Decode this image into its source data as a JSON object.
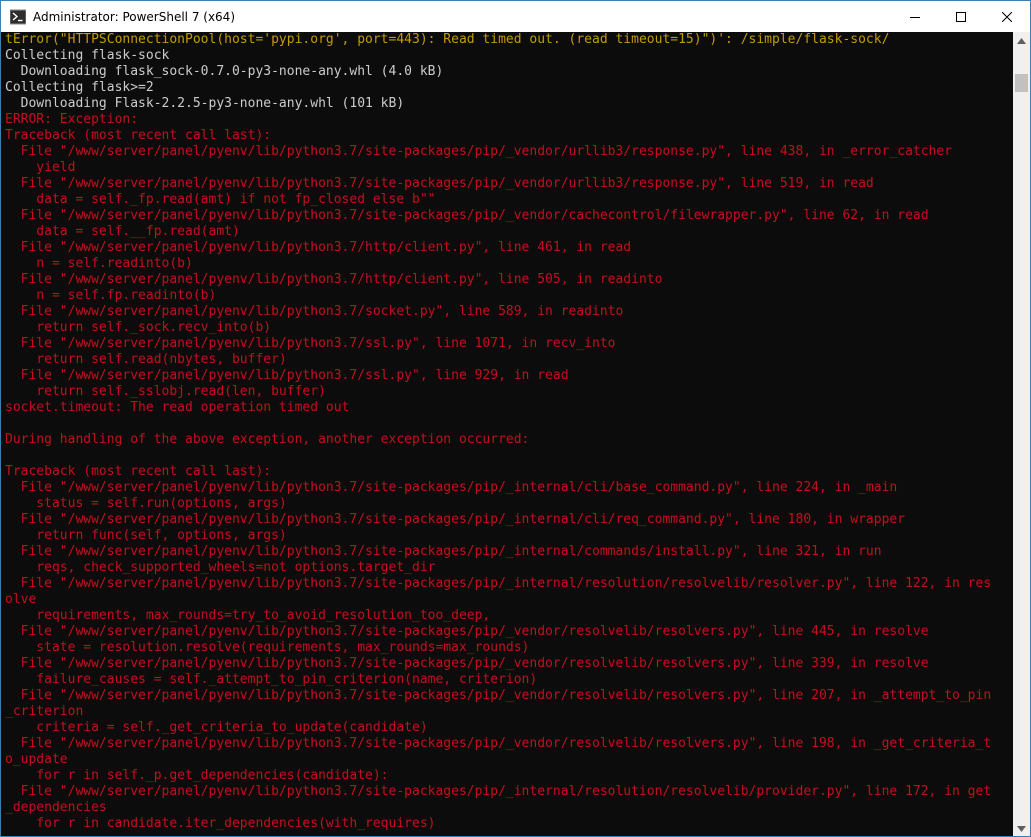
{
  "window": {
    "title": "Administrator: PowerShell 7 (x64)"
  },
  "colors": {
    "title_bar": "#ffffff",
    "terminal_bg": "#0c0c0c",
    "normal": "#cccccc",
    "warning": "#c19c00",
    "error": "#c50f1f"
  },
  "icons": {
    "app": "powershell-icon",
    "minimize": "minimize-icon",
    "maximize": "maximize-icon",
    "close": "close-icon",
    "scroll_up": "scroll-up-arrow-icon",
    "scroll_down": "scroll-down-arrow-icon"
  },
  "terminal": {
    "lines": [
      {
        "text": "tError(\"HTTPSConnectionPool(host='pypi.org', port=443): Read timed out. (read timeout=15)\")': /simple/flask-sock/",
        "color": "#c19c00"
      },
      {
        "text": "Collecting flask-sock",
        "color": "#cccccc"
      },
      {
        "text": "  Downloading flask_sock-0.7.0-py3-none-any.whl (4.0 kB)",
        "color": "#cccccc"
      },
      {
        "text": "Collecting flask>=2",
        "color": "#cccccc"
      },
      {
        "text": "  Downloading Flask-2.2.5-py3-none-any.whl (101 kB)",
        "color": "#cccccc"
      },
      {
        "text": "ERROR: Exception:",
        "color": "#c50f1f"
      },
      {
        "text": "Traceback (most recent call last):",
        "color": "#c50f1f"
      },
      {
        "text": "  File \"/www/server/panel/pyenv/lib/python3.7/site-packages/pip/_vendor/urllib3/response.py\", line 438, in _error_catcher",
        "color": "#c50f1f"
      },
      {
        "text": "    yield",
        "color": "#c50f1f"
      },
      {
        "text": "  File \"/www/server/panel/pyenv/lib/python3.7/site-packages/pip/_vendor/urllib3/response.py\", line 519, in read",
        "color": "#c50f1f"
      },
      {
        "text": "    data = self._fp.read(amt) if not fp_closed else b\"\"",
        "color": "#c50f1f"
      },
      {
        "text": "  File \"/www/server/panel/pyenv/lib/python3.7/site-packages/pip/_vendor/cachecontrol/filewrapper.py\", line 62, in read",
        "color": "#c50f1f"
      },
      {
        "text": "    data = self.__fp.read(amt)",
        "color": "#c50f1f"
      },
      {
        "text": "  File \"/www/server/panel/pyenv/lib/python3.7/http/client.py\", line 461, in read",
        "color": "#c50f1f"
      },
      {
        "text": "    n = self.readinto(b)",
        "color": "#c50f1f"
      },
      {
        "text": "  File \"/www/server/panel/pyenv/lib/python3.7/http/client.py\", line 505, in readinto",
        "color": "#c50f1f"
      },
      {
        "text": "    n = self.fp.readinto(b)",
        "color": "#c50f1f"
      },
      {
        "text": "  File \"/www/server/panel/pyenv/lib/python3.7/socket.py\", line 589, in readinto",
        "color": "#c50f1f"
      },
      {
        "text": "    return self._sock.recv_into(b)",
        "color": "#c50f1f"
      },
      {
        "text": "  File \"/www/server/panel/pyenv/lib/python3.7/ssl.py\", line 1071, in recv_into",
        "color": "#c50f1f"
      },
      {
        "text": "    return self.read(nbytes, buffer)",
        "color": "#c50f1f"
      },
      {
        "text": "  File \"/www/server/panel/pyenv/lib/python3.7/ssl.py\", line 929, in read",
        "color": "#c50f1f"
      },
      {
        "text": "    return self._sslobj.read(len, buffer)",
        "color": "#c50f1f"
      },
      {
        "text": "socket.timeout: The read operation timed out",
        "color": "#c50f1f"
      },
      {
        "text": "",
        "color": "#c50f1f"
      },
      {
        "text": "During handling of the above exception, another exception occurred:",
        "color": "#c50f1f"
      },
      {
        "text": "",
        "color": "#c50f1f"
      },
      {
        "text": "Traceback (most recent call last):",
        "color": "#c50f1f"
      },
      {
        "text": "  File \"/www/server/panel/pyenv/lib/python3.7/site-packages/pip/_internal/cli/base_command.py\", line 224, in _main",
        "color": "#c50f1f"
      },
      {
        "text": "    status = self.run(options, args)",
        "color": "#c50f1f"
      },
      {
        "text": "  File \"/www/server/panel/pyenv/lib/python3.7/site-packages/pip/_internal/cli/req_command.py\", line 180, in wrapper",
        "color": "#c50f1f"
      },
      {
        "text": "    return func(self, options, args)",
        "color": "#c50f1f"
      },
      {
        "text": "  File \"/www/server/panel/pyenv/lib/python3.7/site-packages/pip/_internal/commands/install.py\", line 321, in run",
        "color": "#c50f1f"
      },
      {
        "text": "    reqs, check_supported_wheels=not options.target_dir",
        "color": "#c50f1f"
      },
      {
        "text": "  File \"/www/server/panel/pyenv/lib/python3.7/site-packages/pip/_internal/resolution/resolvelib/resolver.py\", line 122, in res",
        "color": "#c50f1f"
      },
      {
        "text": "olve",
        "color": "#c50f1f"
      },
      {
        "text": "    requirements, max_rounds=try_to_avoid_resolution_too_deep,",
        "color": "#c50f1f"
      },
      {
        "text": "  File \"/www/server/panel/pyenv/lib/python3.7/site-packages/pip/_vendor/resolvelib/resolvers.py\", line 445, in resolve",
        "color": "#c50f1f"
      },
      {
        "text": "    state = resolution.resolve(requirements, max_rounds=max_rounds)",
        "color": "#c50f1f"
      },
      {
        "text": "  File \"/www/server/panel/pyenv/lib/python3.7/site-packages/pip/_vendor/resolvelib/resolvers.py\", line 339, in resolve",
        "color": "#c50f1f"
      },
      {
        "text": "    failure_causes = self._attempt_to_pin_criterion(name, criterion)",
        "color": "#c50f1f"
      },
      {
        "text": "  File \"/www/server/panel/pyenv/lib/python3.7/site-packages/pip/_vendor/resolvelib/resolvers.py\", line 207, in _attempt_to_pin",
        "color": "#c50f1f"
      },
      {
        "text": "_criterion",
        "color": "#c50f1f"
      },
      {
        "text": "    criteria = self._get_criteria_to_update(candidate)",
        "color": "#c50f1f"
      },
      {
        "text": "  File \"/www/server/panel/pyenv/lib/python3.7/site-packages/pip/_vendor/resolvelib/resolvers.py\", line 198, in _get_criteria_t",
        "color": "#c50f1f"
      },
      {
        "text": "o_update",
        "color": "#c50f1f"
      },
      {
        "text": "    for r in self._p.get_dependencies(candidate):",
        "color": "#c50f1f"
      },
      {
        "text": "  File \"/www/server/panel/pyenv/lib/python3.7/site-packages/pip/_internal/resolution/resolvelib/provider.py\", line 172, in get",
        "color": "#c50f1f"
      },
      {
        "text": "_dependencies",
        "color": "#c50f1f"
      },
      {
        "text": "    for r in candidate.iter_dependencies(with_requires)",
        "color": "#c50f1f"
      }
    ]
  }
}
